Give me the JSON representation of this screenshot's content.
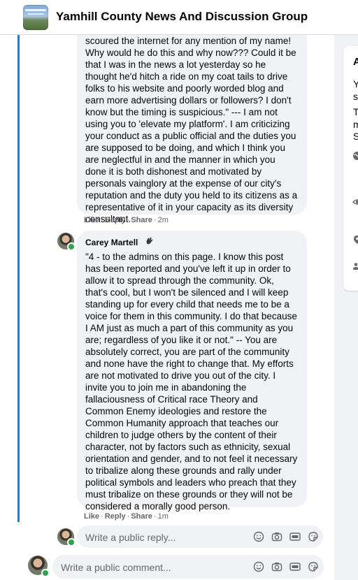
{
  "header": {
    "group_name": "Yamhill County News And Discussion Group",
    "thumbnail_icon": "group-cover-image"
  },
  "comments": [
    {
      "text": "scoured the internet for any mention of my name! Why would he do this and why now??? Could it be that I was in the news a lot yesterday so he thought he'd hitch a ride on my coat tails to drive folks to his website and poorly worded blog and earn more advertising dollars or followers? I don't know but the timing is suspicious.\" --- I am not using you to 'elevate my platform'. I am criticizing your conduct as a public official and the duties you are supposed to be doing, and which I think you are neglectful in and the manner in which you done it is both dishonest and motivated by personals vainglory at the expense of our city's reputation and the duty you held to its citizens as a representative of it in your capacity as its diversity consultant.",
      "like": "Like",
      "reply": "Reply",
      "share": "Share",
      "time": "2m"
    },
    {
      "author": "Carey Martell",
      "badge_icon": "clapping-hands-icon",
      "text": "\"4 - to the admins on this page. I know this post has been reported and you've left it up in order to allow it to spread through the community. Ok, that's cool, but I won't be silenced and I will keep standing up for every child that needs me to be a voice for them in this community. I do that because I AM just as much a part of this community as you are; regardless of you like it or not.\" -- You are absolutely correct, you are part of the community and none have the right to change that. My efforts are not motivated to drive you out of the city. I invite you to join me in abandoning the fallaciousness of Critical race Theory and Common Enemy ideologies and restore the Common Humanity approach that teaches our children to judge others by the content of their character, not by factors such as ethnicity, sexual orientation and gender, and to not feel it necessary to tribalize along these grounds and rally under political symbols and leaders who preach that they must tribalize on these grounds or they will not be considered a morally good person.",
      "like": "Like",
      "reply": "Reply",
      "share": "Share",
      "time": "1m"
    }
  ],
  "reply_box": {
    "placeholder": "Write a public reply..."
  },
  "comment_box": {
    "placeholder": "Write a public comment..."
  },
  "toolbar_icons": [
    "emoji-icon",
    "camera-icon",
    "gif-icon",
    "sticker-icon"
  ],
  "side_panel": {
    "heading": "A",
    "lines": [
      "Y",
      "s",
      "T",
      "m",
      "S"
    ]
  },
  "colors": {
    "thread_line": "#1877f2",
    "bubble_bg": "#f0f2f5",
    "online": "#31a24c",
    "meta_text": "#65676b"
  }
}
